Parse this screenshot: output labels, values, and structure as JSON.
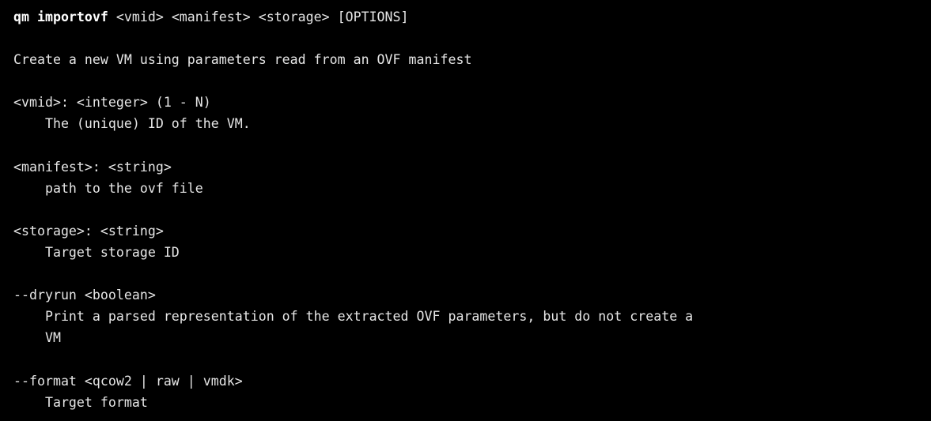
{
  "terminal": {
    "background_color": "#000000",
    "text_color": "#e6e6e6",
    "usage": {
      "command": "qm importovf",
      "arguments": " <vmid> <manifest> <storage> [OPTIONS]"
    },
    "description": "Create a new VM using parameters read from an OVF manifest",
    "parameters": [
      {
        "signature": "<vmid>: <integer> (1 - N)",
        "description": "    The (unique) ID of the VM."
      },
      {
        "signature": "<manifest>: <string>",
        "description": "    path to the ovf file"
      },
      {
        "signature": "<storage>: <string>",
        "description": "    Target storage ID"
      }
    ],
    "options": [
      {
        "signature": "--dryrun <boolean>",
        "description_lines": [
          "    Print a parsed representation of the extracted OVF parameters, but do not create a",
          "    VM"
        ]
      },
      {
        "signature": "--format <qcow2 | raw | vmdk>",
        "description_lines": [
          "    Target format"
        ]
      }
    ]
  }
}
